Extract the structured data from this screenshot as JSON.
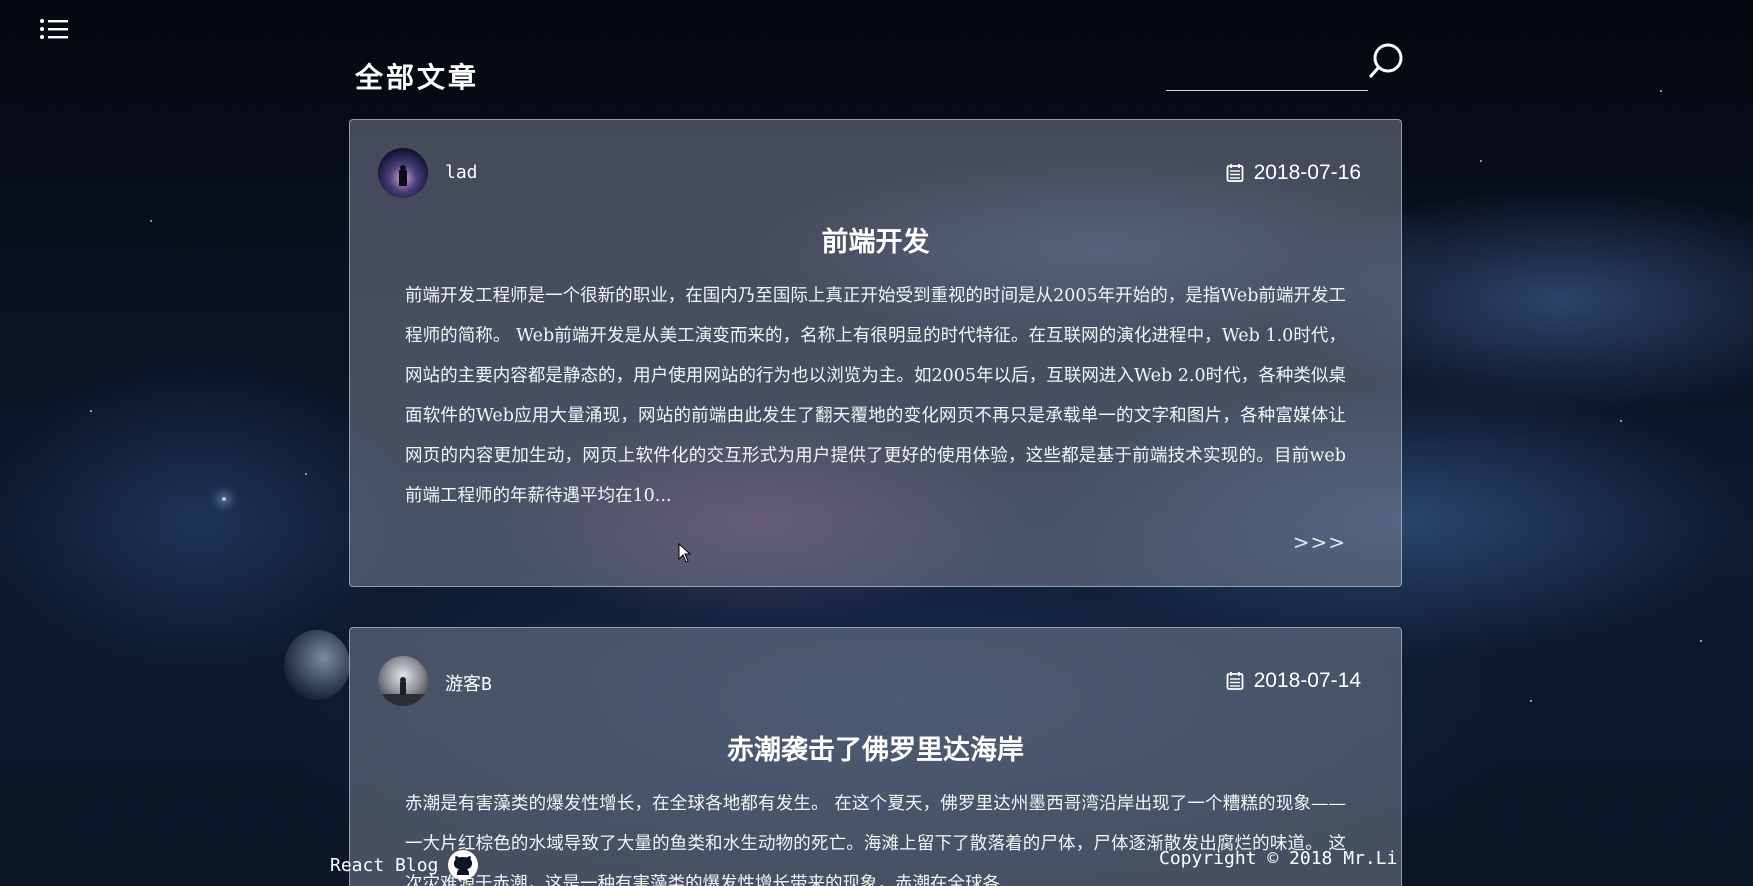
{
  "header": {
    "page_title": "全部文章",
    "menu_icon": "list-menu-icon",
    "search_icon": "search-icon",
    "search": {
      "value": "",
      "placeholder": ""
    }
  },
  "posts": [
    {
      "author": "lad",
      "date": "2018-07-16",
      "title": "前端开发",
      "excerpt": "前端开发工程师是一个很新的职业，在国内乃至国际上真正开始受到重视的时间是从2005年开始的，是指Web前端开发工程师的简称。 Web前端开发是从美工演变而来的，名称上有很明显的时代特征。在互联网的演化进程中，Web 1.0时代，网站的主要内容都是静态的，用户使用网站的行为也以浏览为主。如2005年以后，互联网进入Web 2.0时代，各种类似桌面软件的Web应用大量涌现，网站的前端由此发生了翻天覆地的变化网页不再只是承载单一的文字和图片，各种富媒体让网页的内容更加生动，网页上软件化的交互形式为用户提供了更好的使用体验，这些都是基于前端技术实现的。目前web前端工程师的年薪待遇平均在10...",
      "more_label": ">>>"
    },
    {
      "author": "游客B",
      "date": "2018-07-14",
      "title": "赤潮袭击了佛罗里达海岸",
      "excerpt": "赤潮是有害藻类的爆发性增长，在全球各地都有发生。 在这个夏天，佛罗里达州墨西哥湾沿岸出现了一个糟糕的现象——一大片红棕色的水域导致了大量的鱼类和水生动物的死亡。海滩上留下了散落着的尸体，尸体逐渐散发出腐烂的味道。 这次灾难源于赤潮，这是一种有害藻类的爆发性增长带来的现象，赤潮在全球各"
    }
  ],
  "footer": {
    "left_text": "React Blog",
    "github_icon": "github-icon",
    "copyright": "Copyright © 2018 Mr.Li"
  },
  "colors": {
    "card_background": "rgba(120,128,145,0.55)",
    "card_border": "#c8d2e1",
    "text": "#ffffff"
  }
}
